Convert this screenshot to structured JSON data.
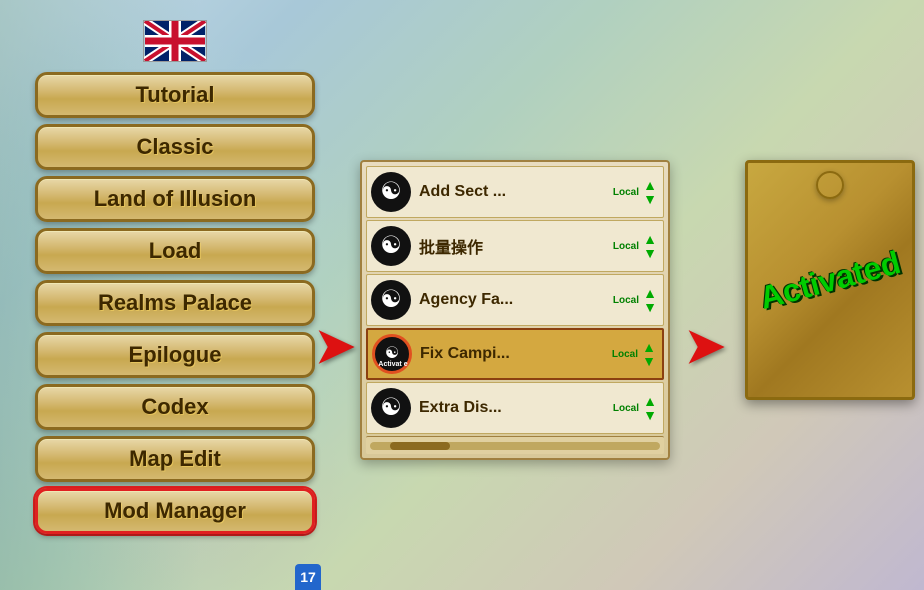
{
  "background": {
    "color": "#b8d4e8"
  },
  "left_panel": {
    "menu_buttons": [
      {
        "id": "tutorial",
        "label": "Tutorial",
        "active": false
      },
      {
        "id": "classic",
        "label": "Classic",
        "active": false
      },
      {
        "id": "land-of-illusion",
        "label": "Land of Illusion",
        "active": false
      },
      {
        "id": "load",
        "label": "Load",
        "active": false
      },
      {
        "id": "realms-palace",
        "label": "Realms Palace",
        "active": false
      },
      {
        "id": "epilogue",
        "label": "Epilogue",
        "active": false
      },
      {
        "id": "codex",
        "label": "Codex",
        "active": false
      },
      {
        "id": "map-edit",
        "label": "Map Edit",
        "active": false
      },
      {
        "id": "mod-manager",
        "label": "Mod Manager",
        "active": true
      }
    ]
  },
  "center_panel": {
    "mods": [
      {
        "id": "add-sect",
        "icon": "yin-yang",
        "name": "Add Sect ...",
        "badge": "Local",
        "highlighted": false
      },
      {
        "id": "batch-ops",
        "icon": "yin-yang",
        "name": "批量操作",
        "badge": "Local",
        "highlighted": false
      },
      {
        "id": "agency-fa",
        "icon": "yin-yang",
        "name": "Agency Fa...",
        "badge": "Local",
        "highlighted": false
      },
      {
        "id": "fix-campi",
        "icon": "activate",
        "name": "Fix Campi...",
        "badge": "Local",
        "highlighted": true
      },
      {
        "id": "extra-dis",
        "icon": "yin-yang",
        "name": "Extra Dis...",
        "badge": "Local",
        "highlighted": false
      }
    ]
  },
  "arrows": {
    "left_arrow": "◀",
    "right_arrow": "▶"
  },
  "right_panel": {
    "activated_text": "Activated"
  },
  "number_badge": "17"
}
